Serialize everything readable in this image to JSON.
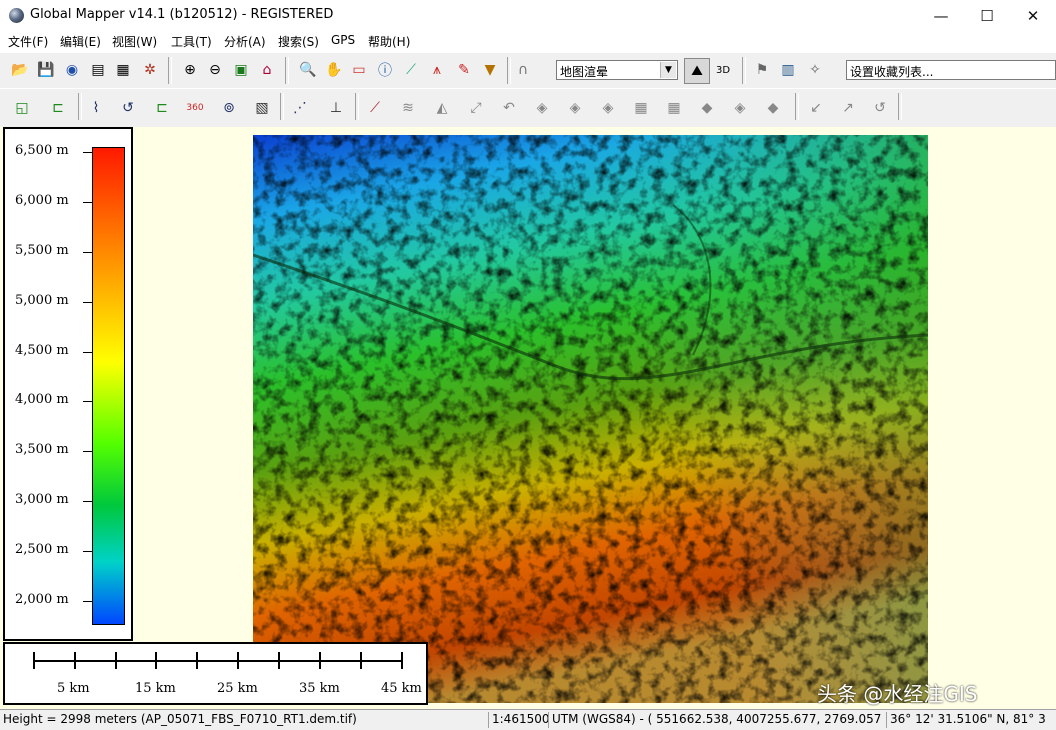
{
  "window": {
    "title": "Global Mapper v14.1 (b120512) - REGISTERED",
    "minimize": "—",
    "maximize": "☐",
    "close": "✕"
  },
  "menu": [
    "文件(F)",
    "编辑(E)",
    "视图(W)",
    "工具(T)",
    "分析(A)",
    "搜索(S)",
    "GPS",
    "帮助(H)"
  ],
  "toolbar1": {
    "icons": [
      "open-icon",
      "save-icon",
      "globe-icon",
      "catalog-icon",
      "config-icon",
      "tools-icon",
      "zoom-in-icon",
      "zoom-out-icon",
      "full-view-icon",
      "home-icon",
      "zoom-tool-icon",
      "pan-icon",
      "measure-icon",
      "info-icon",
      "path-profile-icon",
      "tower-icon",
      "digitize-icon",
      "dropdown-arrow-icon",
      "arch-icon"
    ],
    "shader_combo": "地图渲晕",
    "icons2": [
      "shader-icon",
      "3d-view-icon",
      "flag-icon",
      "image-icon",
      "gps-icon"
    ],
    "favorites_combo": "设置收藏列表..."
  },
  "toolbar2": {
    "icons": [
      "create-area-icon",
      "create-line-icon",
      "create-point-icon",
      "edit-feature-icon",
      "move-feature-icon",
      "coordinates-icon",
      "rotate-icon",
      "grid-icon",
      "vertex-icon",
      "snap-icon",
      "measure-line-icon",
      "buffer-icon",
      "split-icon",
      "join-icon",
      "crop-icon",
      "merge-icon",
      "combine-icon",
      "smooth-icon",
      "simplify-icon",
      "extract-icon",
      "generate-icon",
      "clone-icon",
      "delete-icon",
      "reshape-icon",
      "offset-icon",
      "undo-icon"
    ]
  },
  "legend": {
    "labels": [
      "6,500 m",
      "6,000 m",
      "5,500 m",
      "5,000 m",
      "4,500 m",
      "4,000 m",
      "3,500 m",
      "3,000 m",
      "2,500 m",
      "2,000 m"
    ]
  },
  "scalebar": {
    "labels": [
      "5 km",
      "15 km",
      "25 km",
      "35 km",
      "45 km"
    ]
  },
  "watermark": "头条 @水经注GIS",
  "status": {
    "height": "Height = 2998 meters (AP_05071_FBS_F0710_RT1.dem.tif)",
    "scale": "1:461500",
    "coords": "UTM (WGS84) - ( 551662.538, 4007255.677, 2769.057 m )",
    "latlon": "36° 12' 31.5106\" N, 81° 3"
  }
}
